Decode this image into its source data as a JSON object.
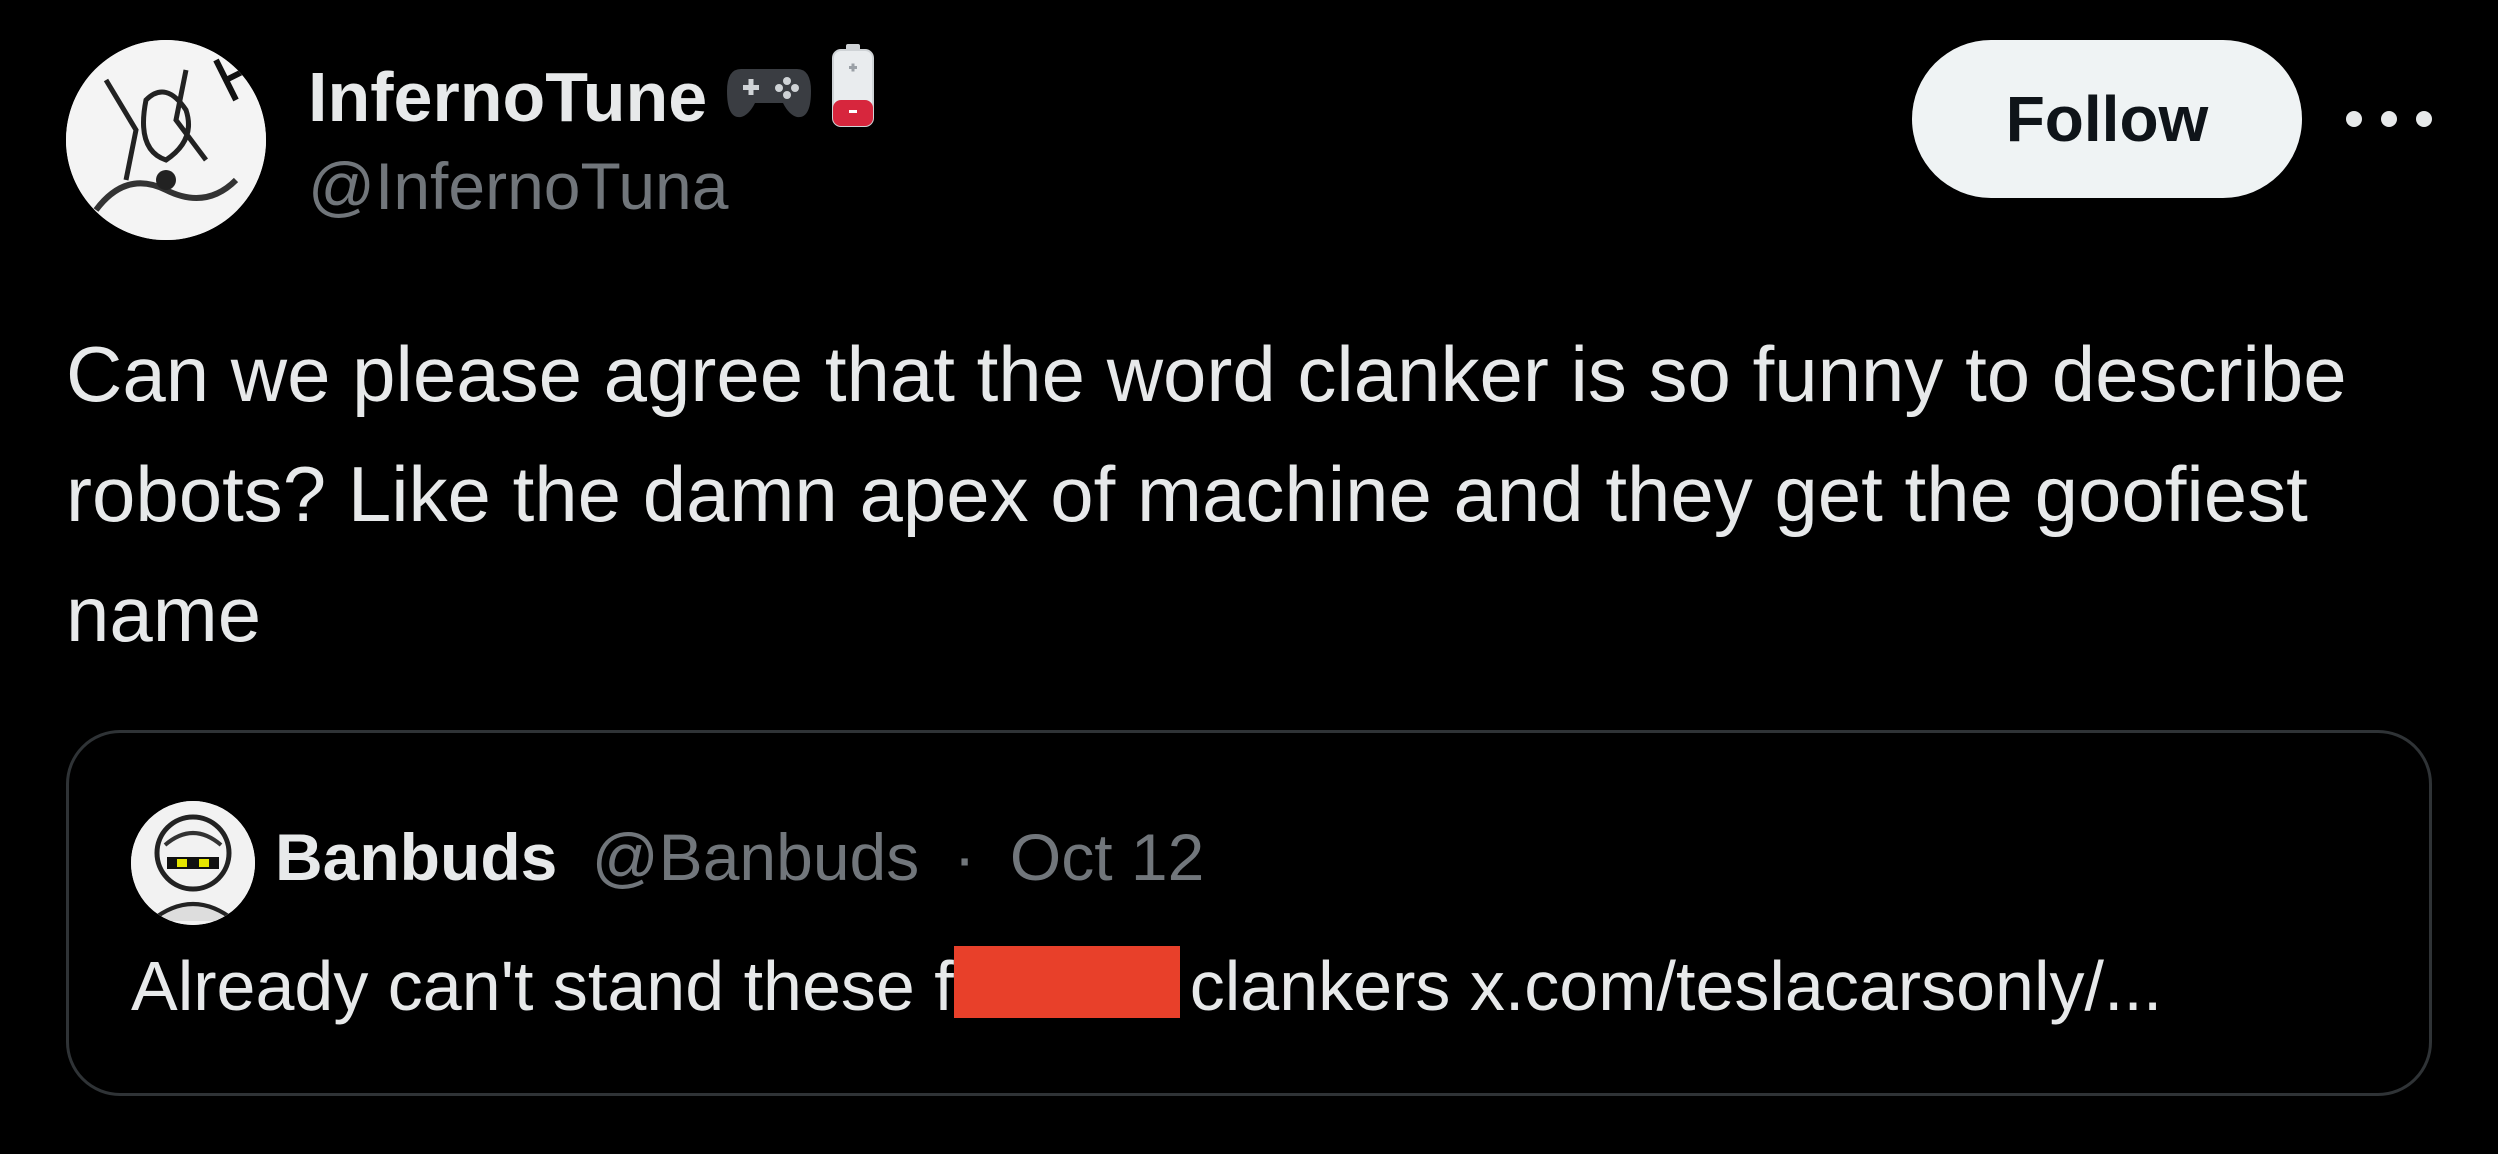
{
  "author": {
    "display_name": "InfernoTune",
    "handle": "@InfernoTuna",
    "emoji_icons": [
      "game-controller-icon",
      "low-battery-icon"
    ]
  },
  "actions": {
    "follow_label": "Follow",
    "more_icon": "more-options-icon"
  },
  "tweet": {
    "text": "Can we please agree that the word clanker is so funny to describe robots? Like the damn apex of machine and they get the goofiest name"
  },
  "quoted": {
    "display_name": "Banbuds",
    "handle": "@Banbuds",
    "separator": "·",
    "date": "Oct 12",
    "text_before": "Already can't stand these f",
    "text_after": "clankers x.com/teslacarsonly/...",
    "redaction_color": "#e8402a"
  },
  "colors": {
    "background": "#000000",
    "primary_text": "#e7e9ea",
    "secondary_text": "#71767b",
    "follow_bg": "#eff3f4",
    "border": "#2f3336"
  }
}
